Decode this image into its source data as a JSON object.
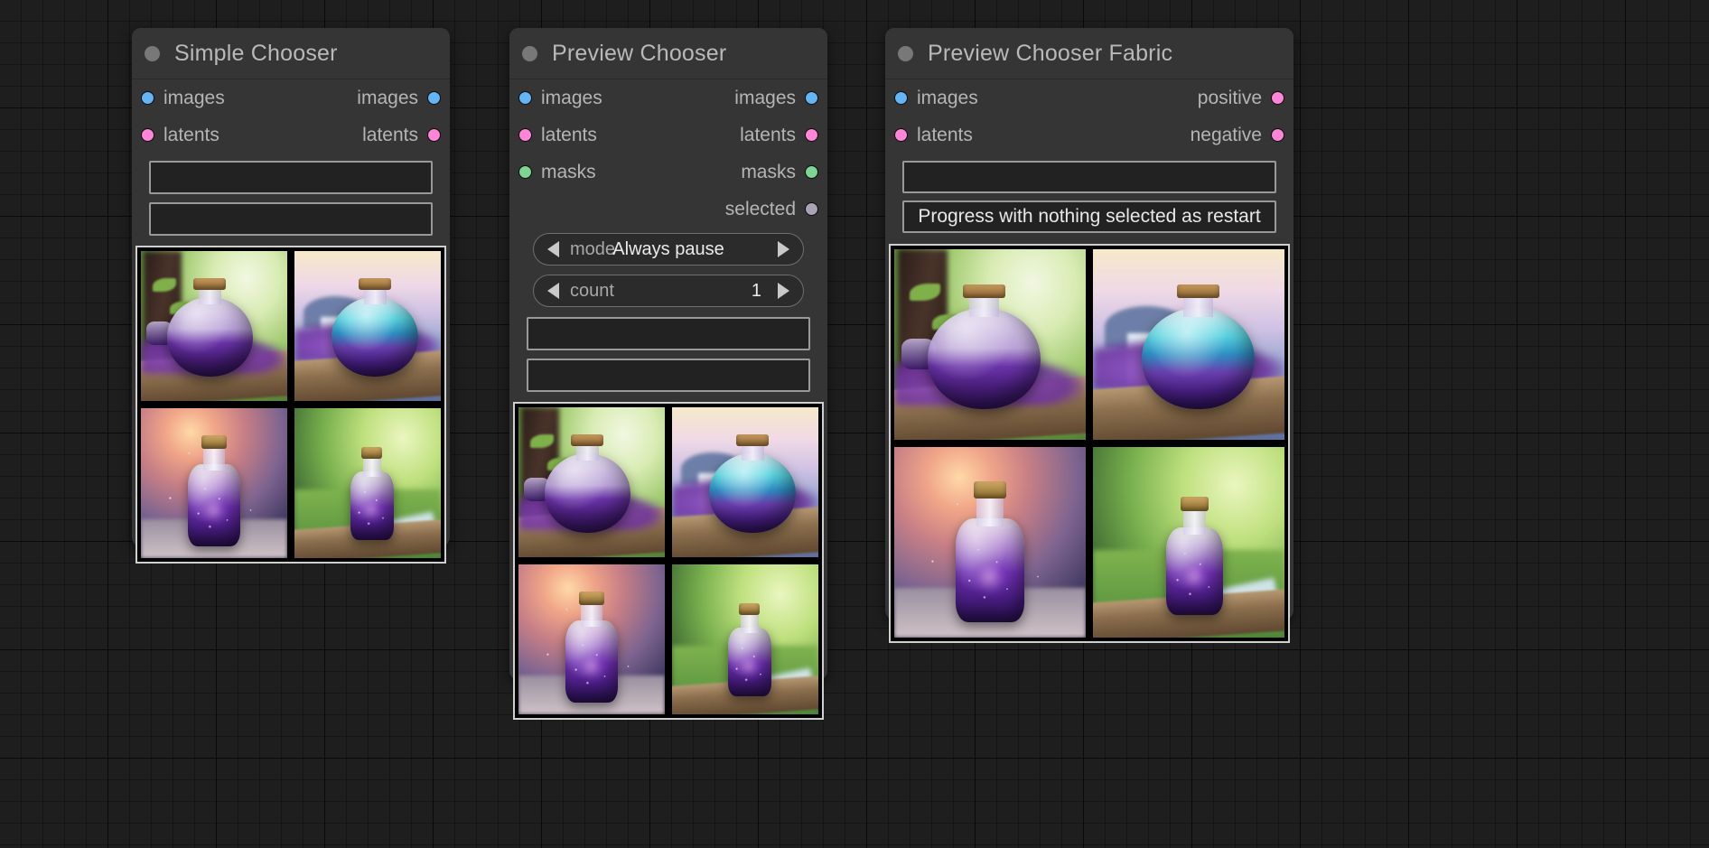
{
  "canvas": {
    "background_color": "#1e1e1e",
    "grid_color": "#161616"
  },
  "nodes": [
    {
      "id": "simple-chooser",
      "title": "Simple Chooser",
      "inputs": [
        {
          "label": "images",
          "color": "#64b5f6"
        },
        {
          "label": "latents",
          "color": "#ff85d8"
        }
      ],
      "outputs": [
        {
          "label": "images",
          "color": "#64b5f6"
        },
        {
          "label": "latents",
          "color": "#ff85d8"
        }
      ],
      "buttons": [
        {
          "label": ""
        },
        {
          "label": ""
        }
      ],
      "combos": [],
      "gallery": {
        "columns": 2,
        "rows": 2,
        "images": [
          "round-purple-bottle-forest",
          "round-cyan-bottle-lake",
          "tall-galaxy-bottle-sunset",
          "tall-galaxy-bottle-stream"
        ]
      }
    },
    {
      "id": "preview-chooser",
      "title": "Preview Chooser",
      "inputs": [
        {
          "label": "images",
          "color": "#64b5f6"
        },
        {
          "label": "latents",
          "color": "#ff85d8"
        },
        {
          "label": "masks",
          "color": "#7ed492"
        }
      ],
      "outputs": [
        {
          "label": "images",
          "color": "#64b5f6"
        },
        {
          "label": "latents",
          "color": "#ff85d8"
        },
        {
          "label": "masks",
          "color": "#7ed492"
        },
        {
          "label": "selected",
          "color": "#a9a3b5"
        }
      ],
      "combos": [
        {
          "name": "mode",
          "value": "Always pause",
          "left_arrow": "prev-arrow-icon",
          "right_arrow": "next-arrow-icon"
        },
        {
          "name": "count",
          "value": "1",
          "left_arrow": "prev-arrow-icon",
          "right_arrow": "next-arrow-icon"
        }
      ],
      "buttons": [
        {
          "label": ""
        },
        {
          "label": ""
        }
      ],
      "gallery": {
        "columns": 2,
        "rows": 2,
        "images": [
          "round-purple-bottle-forest",
          "round-cyan-bottle-lake",
          "tall-galaxy-bottle-sunset",
          "tall-galaxy-bottle-stream"
        ]
      }
    },
    {
      "id": "preview-chooser-fabric",
      "title": "Preview Chooser Fabric",
      "inputs": [
        {
          "label": "images",
          "color": "#64b5f6"
        },
        {
          "label": "latents",
          "color": "#ff85d8"
        }
      ],
      "outputs": [
        {
          "label": "positive",
          "color": "#ff85d8"
        },
        {
          "label": "negative",
          "color": "#ff85d8"
        }
      ],
      "combos": [],
      "buttons": [
        {
          "label": ""
        },
        {
          "label": "Progress with nothing selected as restart"
        }
      ],
      "gallery": {
        "columns": 2,
        "rows": 2,
        "images": [
          "round-purple-bottle-forest",
          "round-cyan-bottle-lake",
          "tall-galaxy-bottle-sunset",
          "tall-galaxy-bottle-stream"
        ]
      }
    }
  ]
}
